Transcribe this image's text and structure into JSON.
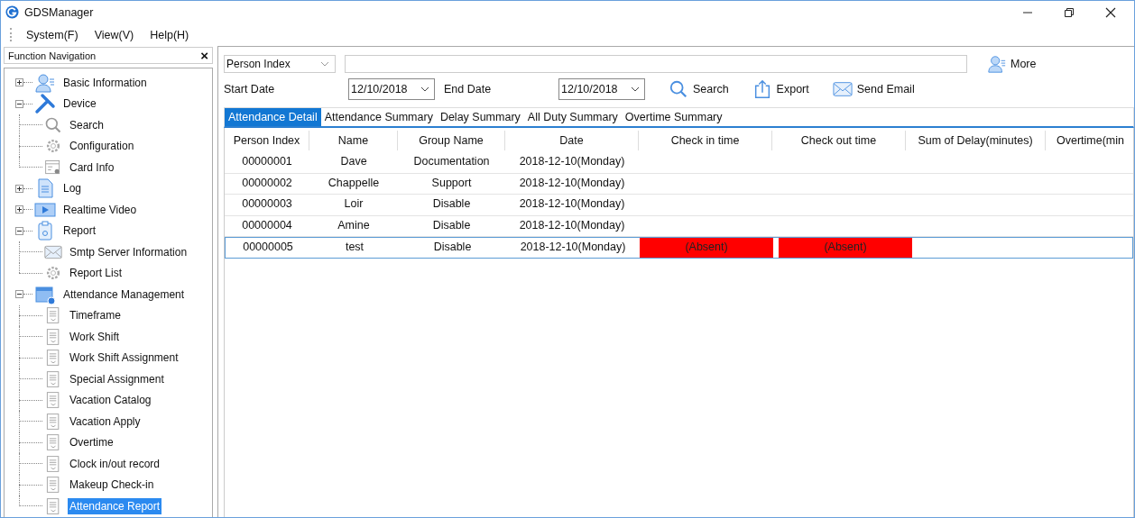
{
  "window": {
    "title": "GDSManager"
  },
  "menu": [
    "System(F)",
    "View(V)",
    "Help(H)"
  ],
  "navigation": {
    "title": "Function Navigation",
    "close": "×",
    "items": [
      {
        "label": "Basic Information",
        "expanded": false,
        "selected": false
      },
      {
        "label": "Device",
        "expanded": true,
        "selected": false,
        "children": [
          {
            "label": "Search",
            "selected": false
          },
          {
            "label": "Configuration",
            "selected": false
          },
          {
            "label": "Card Info",
            "selected": false
          }
        ]
      },
      {
        "label": "Log",
        "expanded": false,
        "selected": false
      },
      {
        "label": "Realtime Video",
        "expanded": false,
        "selected": false
      },
      {
        "label": "Report",
        "expanded": true,
        "selected": false,
        "children": [
          {
            "label": "Smtp Server Information",
            "selected": false
          },
          {
            "label": "Report List",
            "selected": false
          }
        ]
      },
      {
        "label": "Attendance Management",
        "expanded": true,
        "selected": false,
        "children": [
          {
            "label": "Timeframe",
            "selected": false
          },
          {
            "label": "Work Shift",
            "selected": false
          },
          {
            "label": "Work Shift Assignment",
            "selected": false
          },
          {
            "label": "Special Assignment",
            "selected": false
          },
          {
            "label": "Vacation Catalog",
            "selected": false
          },
          {
            "label": "Vacation Apply",
            "selected": false
          },
          {
            "label": "Overtime",
            "selected": false
          },
          {
            "label": "Clock in/out record",
            "selected": false
          },
          {
            "label": "Makeup Check-in",
            "selected": false
          },
          {
            "label": "Attendance Report",
            "selected": true
          }
        ]
      }
    ]
  },
  "filter": {
    "field": "Person Index",
    "more": "More",
    "start_label": "Start Date",
    "start_date": "12/10/2018",
    "end_label": "End Date",
    "end_date": "12/10/2018",
    "buttons": [
      "Search",
      "Export",
      "Send Email"
    ]
  },
  "tabs": [
    {
      "label": "Attendance Detail",
      "selected": true
    },
    {
      "label": "Attendance Summary",
      "selected": false
    },
    {
      "label": "Delay Summary",
      "selected": false
    },
    {
      "label": "All Duty Summary",
      "selected": false
    },
    {
      "label": "Overtime Summary",
      "selected": false
    }
  ],
  "table": {
    "columns": [
      "Person Index",
      "Name",
      "Group Name",
      "Date",
      "Check in time",
      "Check out time",
      "Sum of Delay(minutes)",
      "Overtime(min"
    ],
    "rows": [
      {
        "cells": [
          "00000001",
          "Dave",
          "Documentation",
          "2018-12-10(Monday)"
        ],
        "absent": false,
        "selected": false
      },
      {
        "cells": [
          "00000002",
          "Chappelle",
          "Support",
          "2018-12-10(Monday)"
        ],
        "absent": false,
        "selected": false
      },
      {
        "cells": [
          "00000003",
          "Loir",
          "Disable",
          "2018-12-10(Monday)"
        ],
        "absent": false,
        "selected": false
      },
      {
        "cells": [
          "00000004",
          "Amine",
          "Disable",
          "2018-12-10(Monday)"
        ],
        "absent": false,
        "selected": false
      },
      {
        "cells": [
          "00000005",
          "test",
          "Disable",
          "2018-12-10(Monday)",
          "(Absent)",
          "(Absent)"
        ],
        "absent": true,
        "selected": true
      }
    ]
  }
}
